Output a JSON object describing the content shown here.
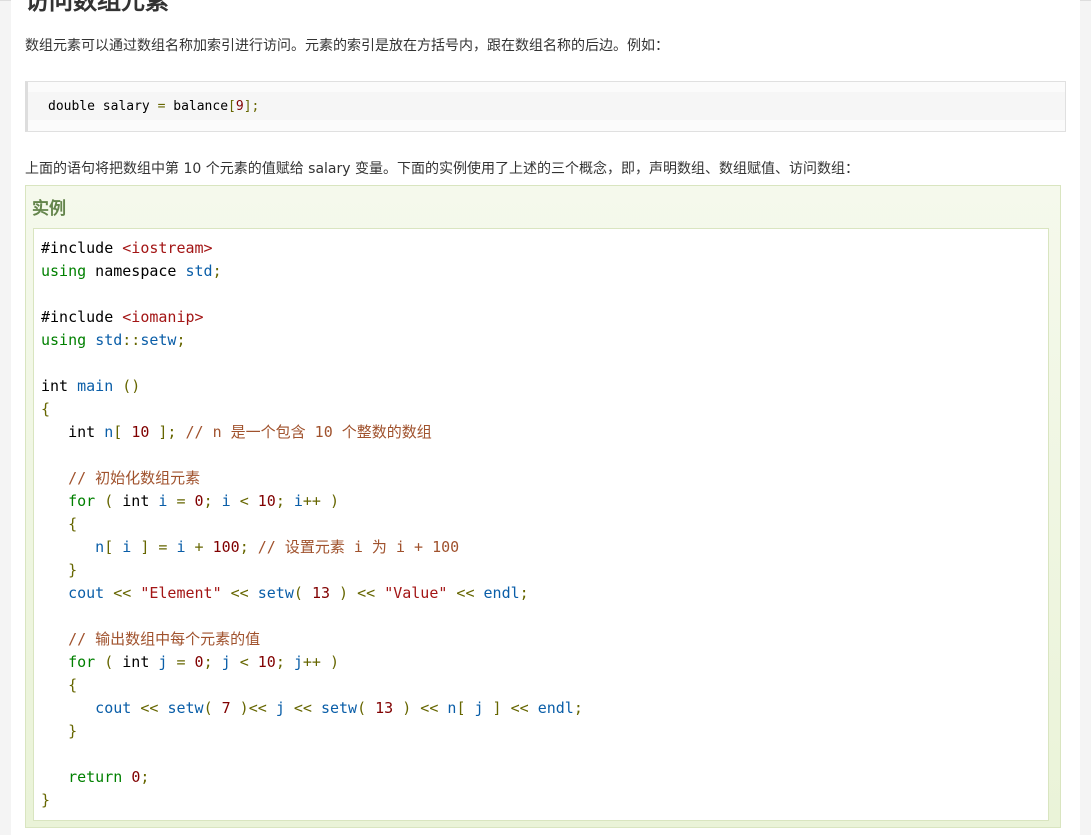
{
  "heading": "访问数组元素",
  "intro": "数组元素可以通过数组名称加索引进行访问。元素的索引是放在方括号内，跟在数组名称的后边。例如：",
  "snippet": {
    "tokens": [
      {
        "t": "double",
        "c": "typ"
      },
      {
        "t": " salary ",
        "c": "typ"
      },
      {
        "t": "=",
        "c": "pun"
      },
      {
        "t": " balance",
        "c": "typ"
      },
      {
        "t": "[",
        "c": "pun"
      },
      {
        "t": "9",
        "c": "num-c"
      },
      {
        "t": "];",
        "c": "pun"
      }
    ]
  },
  "desc": "上面的语句将把数组中第 10 个元素的值赋给 salary 变量。下面的实例使用了上述的三个概念，即，声明数组、数组赋值、访问数组：",
  "example_title": "实例",
  "code_lines": [
    [
      {
        "t": "#include ",
        "c": "typ"
      },
      {
        "t": "<iostream>",
        "c": "hdr"
      }
    ],
    [
      {
        "t": "using",
        "c": "kw"
      },
      {
        "t": " namespace ",
        "c": "typ"
      },
      {
        "t": "std",
        "c": "id"
      },
      {
        "t": ";",
        "c": "pun"
      }
    ],
    [],
    [
      {
        "t": "#include ",
        "c": "typ"
      },
      {
        "t": "<iomanip>",
        "c": "hdr"
      }
    ],
    [
      {
        "t": "using",
        "c": "kw"
      },
      {
        "t": " ",
        "c": "typ"
      },
      {
        "t": "std",
        "c": "id"
      },
      {
        "t": "::",
        "c": "pun"
      },
      {
        "t": "setw",
        "c": "id"
      },
      {
        "t": ";",
        "c": "pun"
      }
    ],
    [],
    [
      {
        "t": "int",
        "c": "typ"
      },
      {
        "t": " ",
        "c": "typ"
      },
      {
        "t": "main",
        "c": "fn"
      },
      {
        "t": " ()",
        "c": "pun"
      }
    ],
    [
      {
        "t": "{",
        "c": "pun"
      }
    ],
    [
      {
        "t": "   int",
        "c": "typ"
      },
      {
        "t": " n",
        "c": "id"
      },
      {
        "t": "[ ",
        "c": "pun"
      },
      {
        "t": "10",
        "c": "num-c"
      },
      {
        "t": " ]; ",
        "c": "pun"
      },
      {
        "t": "// n 是一个包含 10 个整数的数组",
        "c": "cmt"
      }
    ],
    [],
    [
      {
        "t": "   // 初始化数组元素",
        "c": "cmt"
      }
    ],
    [
      {
        "t": "   for",
        "c": "kw"
      },
      {
        "t": " ( ",
        "c": "pun"
      },
      {
        "t": "int",
        "c": "typ"
      },
      {
        "t": " i ",
        "c": "id"
      },
      {
        "t": "= ",
        "c": "pun"
      },
      {
        "t": "0",
        "c": "num-c"
      },
      {
        "t": "; ",
        "c": "pun"
      },
      {
        "t": "i ",
        "c": "id"
      },
      {
        "t": "< ",
        "c": "pun"
      },
      {
        "t": "10",
        "c": "num-c"
      },
      {
        "t": "; ",
        "c": "pun"
      },
      {
        "t": "i",
        "c": "id"
      },
      {
        "t": "++ )",
        "c": "pun"
      }
    ],
    [
      {
        "t": "   {",
        "c": "pun"
      }
    ],
    [
      {
        "t": "      n",
        "c": "id"
      },
      {
        "t": "[ ",
        "c": "pun"
      },
      {
        "t": "i",
        "c": "id"
      },
      {
        "t": " ] = ",
        "c": "pun"
      },
      {
        "t": "i ",
        "c": "id"
      },
      {
        "t": "+ ",
        "c": "pun"
      },
      {
        "t": "100",
        "c": "num-c"
      },
      {
        "t": "; ",
        "c": "pun"
      },
      {
        "t": "// 设置元素 i 为 i + 100",
        "c": "cmt"
      }
    ],
    [
      {
        "t": "   }",
        "c": "pun"
      }
    ],
    [
      {
        "t": "   cout",
        "c": "id"
      },
      {
        "t": " << ",
        "c": "pun"
      },
      {
        "t": "\"Element\"",
        "c": "str"
      },
      {
        "t": " << ",
        "c": "pun"
      },
      {
        "t": "setw",
        "c": "id"
      },
      {
        "t": "( ",
        "c": "pun"
      },
      {
        "t": "13",
        "c": "num-c"
      },
      {
        "t": " ) << ",
        "c": "pun"
      },
      {
        "t": "\"Value\"",
        "c": "str"
      },
      {
        "t": " << ",
        "c": "pun"
      },
      {
        "t": "endl",
        "c": "id"
      },
      {
        "t": ";",
        "c": "pun"
      }
    ],
    [],
    [
      {
        "t": "   // 输出数组中每个元素的值",
        "c": "cmt"
      }
    ],
    [
      {
        "t": "   for",
        "c": "kw"
      },
      {
        "t": " ( ",
        "c": "pun"
      },
      {
        "t": "int",
        "c": "typ"
      },
      {
        "t": " j ",
        "c": "id"
      },
      {
        "t": "= ",
        "c": "pun"
      },
      {
        "t": "0",
        "c": "num-c"
      },
      {
        "t": "; ",
        "c": "pun"
      },
      {
        "t": "j ",
        "c": "id"
      },
      {
        "t": "< ",
        "c": "pun"
      },
      {
        "t": "10",
        "c": "num-c"
      },
      {
        "t": "; ",
        "c": "pun"
      },
      {
        "t": "j",
        "c": "id"
      },
      {
        "t": "++ )",
        "c": "pun"
      }
    ],
    [
      {
        "t": "   {",
        "c": "pun"
      }
    ],
    [
      {
        "t": "      cout",
        "c": "id"
      },
      {
        "t": " << ",
        "c": "pun"
      },
      {
        "t": "setw",
        "c": "id"
      },
      {
        "t": "( ",
        "c": "pun"
      },
      {
        "t": "7",
        "c": "num-c"
      },
      {
        "t": " )<< ",
        "c": "pun"
      },
      {
        "t": "j",
        "c": "id"
      },
      {
        "t": " << ",
        "c": "pun"
      },
      {
        "t": "setw",
        "c": "id"
      },
      {
        "t": "( ",
        "c": "pun"
      },
      {
        "t": "13",
        "c": "num-c"
      },
      {
        "t": " ) << ",
        "c": "pun"
      },
      {
        "t": "n",
        "c": "id"
      },
      {
        "t": "[ ",
        "c": "pun"
      },
      {
        "t": "j",
        "c": "id"
      },
      {
        "t": " ] << ",
        "c": "pun"
      },
      {
        "t": "endl",
        "c": "id"
      },
      {
        "t": ";",
        "c": "pun"
      }
    ],
    [
      {
        "t": "   }",
        "c": "pun"
      }
    ],
    [],
    [
      {
        "t": "   return",
        "c": "kw"
      },
      {
        "t": " ",
        "c": "typ"
      },
      {
        "t": "0",
        "c": "num-c"
      },
      {
        "t": ";",
        "c": "pun"
      }
    ],
    [
      {
        "t": "}",
        "c": "pun"
      }
    ]
  ]
}
